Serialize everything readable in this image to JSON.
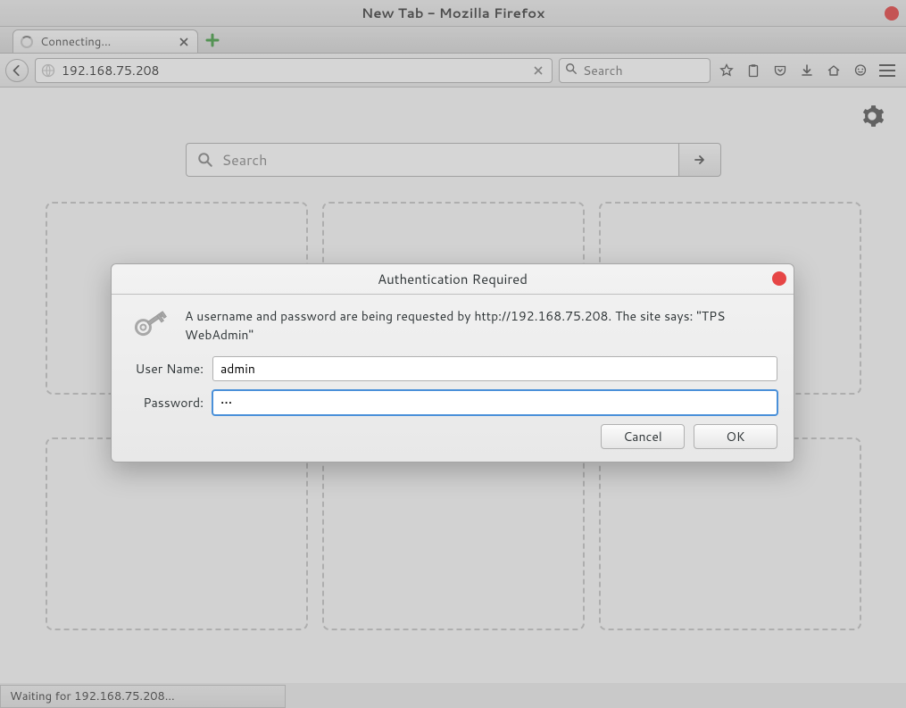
{
  "window": {
    "title": "New Tab - Mozilla Firefox"
  },
  "tabs": [
    {
      "label": "Connecting..."
    }
  ],
  "urlbar": {
    "value": "192.168.75.208"
  },
  "searchbar": {
    "placeholder": "Search"
  },
  "newtab": {
    "search_placeholder": "Search"
  },
  "statusbar": {
    "text": "Waiting for 192.168.75.208..."
  },
  "dialog": {
    "title": "Authentication Required",
    "message": "A username and password are being requested by http://192.168.75.208. The site says: \"TPS WebAdmin\"",
    "username_label": "User Name:",
    "password_label": "Password:",
    "username_value": "admin",
    "password_value": "•••",
    "cancel": "Cancel",
    "ok": "OK"
  }
}
